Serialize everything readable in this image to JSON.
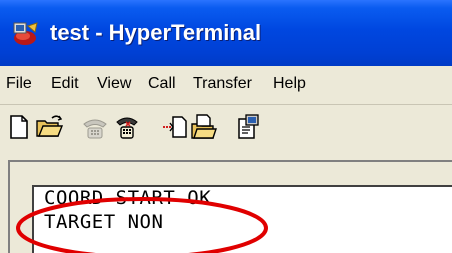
{
  "window": {
    "title": "test - HyperTerminal"
  },
  "menu": {
    "items": [
      "File",
      "Edit",
      "View",
      "Call",
      "Transfer",
      "Help"
    ]
  },
  "toolbar": {
    "buttons": [
      {
        "name": "new-connection",
        "icon": "new-document-icon"
      },
      {
        "name": "open",
        "icon": "open-folder-icon"
      },
      {
        "name": "call",
        "icon": "phone-icon"
      },
      {
        "name": "disconnect",
        "icon": "disconnect-icon"
      },
      {
        "name": "send",
        "icon": "send-document-icon"
      },
      {
        "name": "receive",
        "icon": "receive-folder-icon"
      },
      {
        "name": "properties",
        "icon": "properties-icon"
      }
    ]
  },
  "terminal": {
    "lines": [
      "COORD START OK",
      "TARGET NON"
    ]
  },
  "colors": {
    "titlebar": "#0047e0",
    "highlight_ellipse": "#e00000",
    "chrome": "#ece9d8"
  }
}
